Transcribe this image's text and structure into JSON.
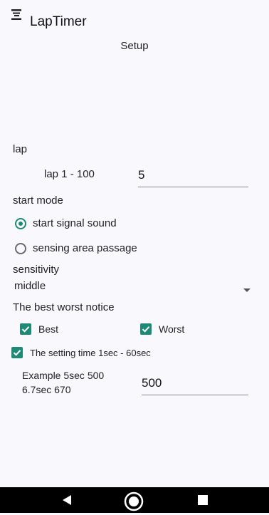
{
  "app": {
    "title": "LapTimer",
    "icon": "app-menu-icon"
  },
  "screen_title": "Setup",
  "lap": {
    "section_label": "lap",
    "range_label": "lap 1 - 100",
    "value": "5"
  },
  "start_mode": {
    "section_label": "start mode",
    "options": [
      {
        "label": "start signal sound",
        "selected": true
      },
      {
        "label": "sensing area passage",
        "selected": false
      }
    ]
  },
  "sensitivity": {
    "section_label": "sensitivity",
    "selected": "middle"
  },
  "notice": {
    "section_label": "The best worst notice",
    "best_label": "Best",
    "best_checked": true,
    "worst_label": "Worst",
    "worst_checked": true
  },
  "setting_time": {
    "label": "The setting time 1sec - 60sec",
    "checked": true,
    "example_line1": "Example 5sec 500",
    "example_line2": "6.7sec 670",
    "value": "500"
  },
  "colors": {
    "accent": "#1e8a76",
    "background": "#f9f8fc",
    "navbar": "#000000"
  },
  "navbar": {
    "back_icon": "back-triangle-icon",
    "home_icon": "home-circle-icon",
    "recents_icon": "recents-square-icon"
  }
}
